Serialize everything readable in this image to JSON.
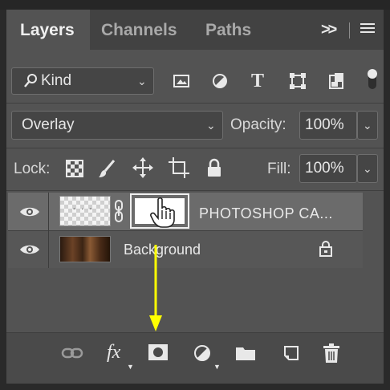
{
  "tabs": [
    {
      "label": "Layers",
      "active": true
    },
    {
      "label": "Channels",
      "active": false
    },
    {
      "label": "Paths",
      "active": false
    }
  ],
  "panel_menu_icons": [
    "collapse-double-chevron-icon",
    "hamburger-menu-icon"
  ],
  "filter": {
    "kind_label": "Kind",
    "kind_icon": "search-icon",
    "type_icons": [
      "image-filter-icon",
      "adjustment-filter-icon",
      "type-filter-icon",
      "shape-filter-icon",
      "smart-object-filter-icon",
      "filter-toggle-icon"
    ]
  },
  "blend": {
    "mode": "Overlay",
    "opacity_label": "Opacity:",
    "opacity_value": "100%"
  },
  "lock": {
    "label": "Lock:",
    "icons": [
      "lock-transparent-pixels-icon",
      "lock-image-pixels-icon",
      "lock-position-icon",
      "lock-artboard-icon",
      "lock-all-icon"
    ],
    "fill_label": "Fill:",
    "fill_value": "100%"
  },
  "layers": [
    {
      "name": "PHOTOSHOP CA...",
      "visible": true,
      "selected": true,
      "has_mask": true
    },
    {
      "name": "Background",
      "visible": true,
      "selected": false,
      "locked": true
    }
  ],
  "annotation": {
    "color": "#ffff00"
  },
  "footer_icons": [
    "link-layers-icon",
    "fx-icon",
    "add-layer-mask-icon",
    "adjustment-layer-icon",
    "new-group-icon",
    "new-layer-icon",
    "delete-layer-icon"
  ],
  "footer_fx_label": "fx"
}
